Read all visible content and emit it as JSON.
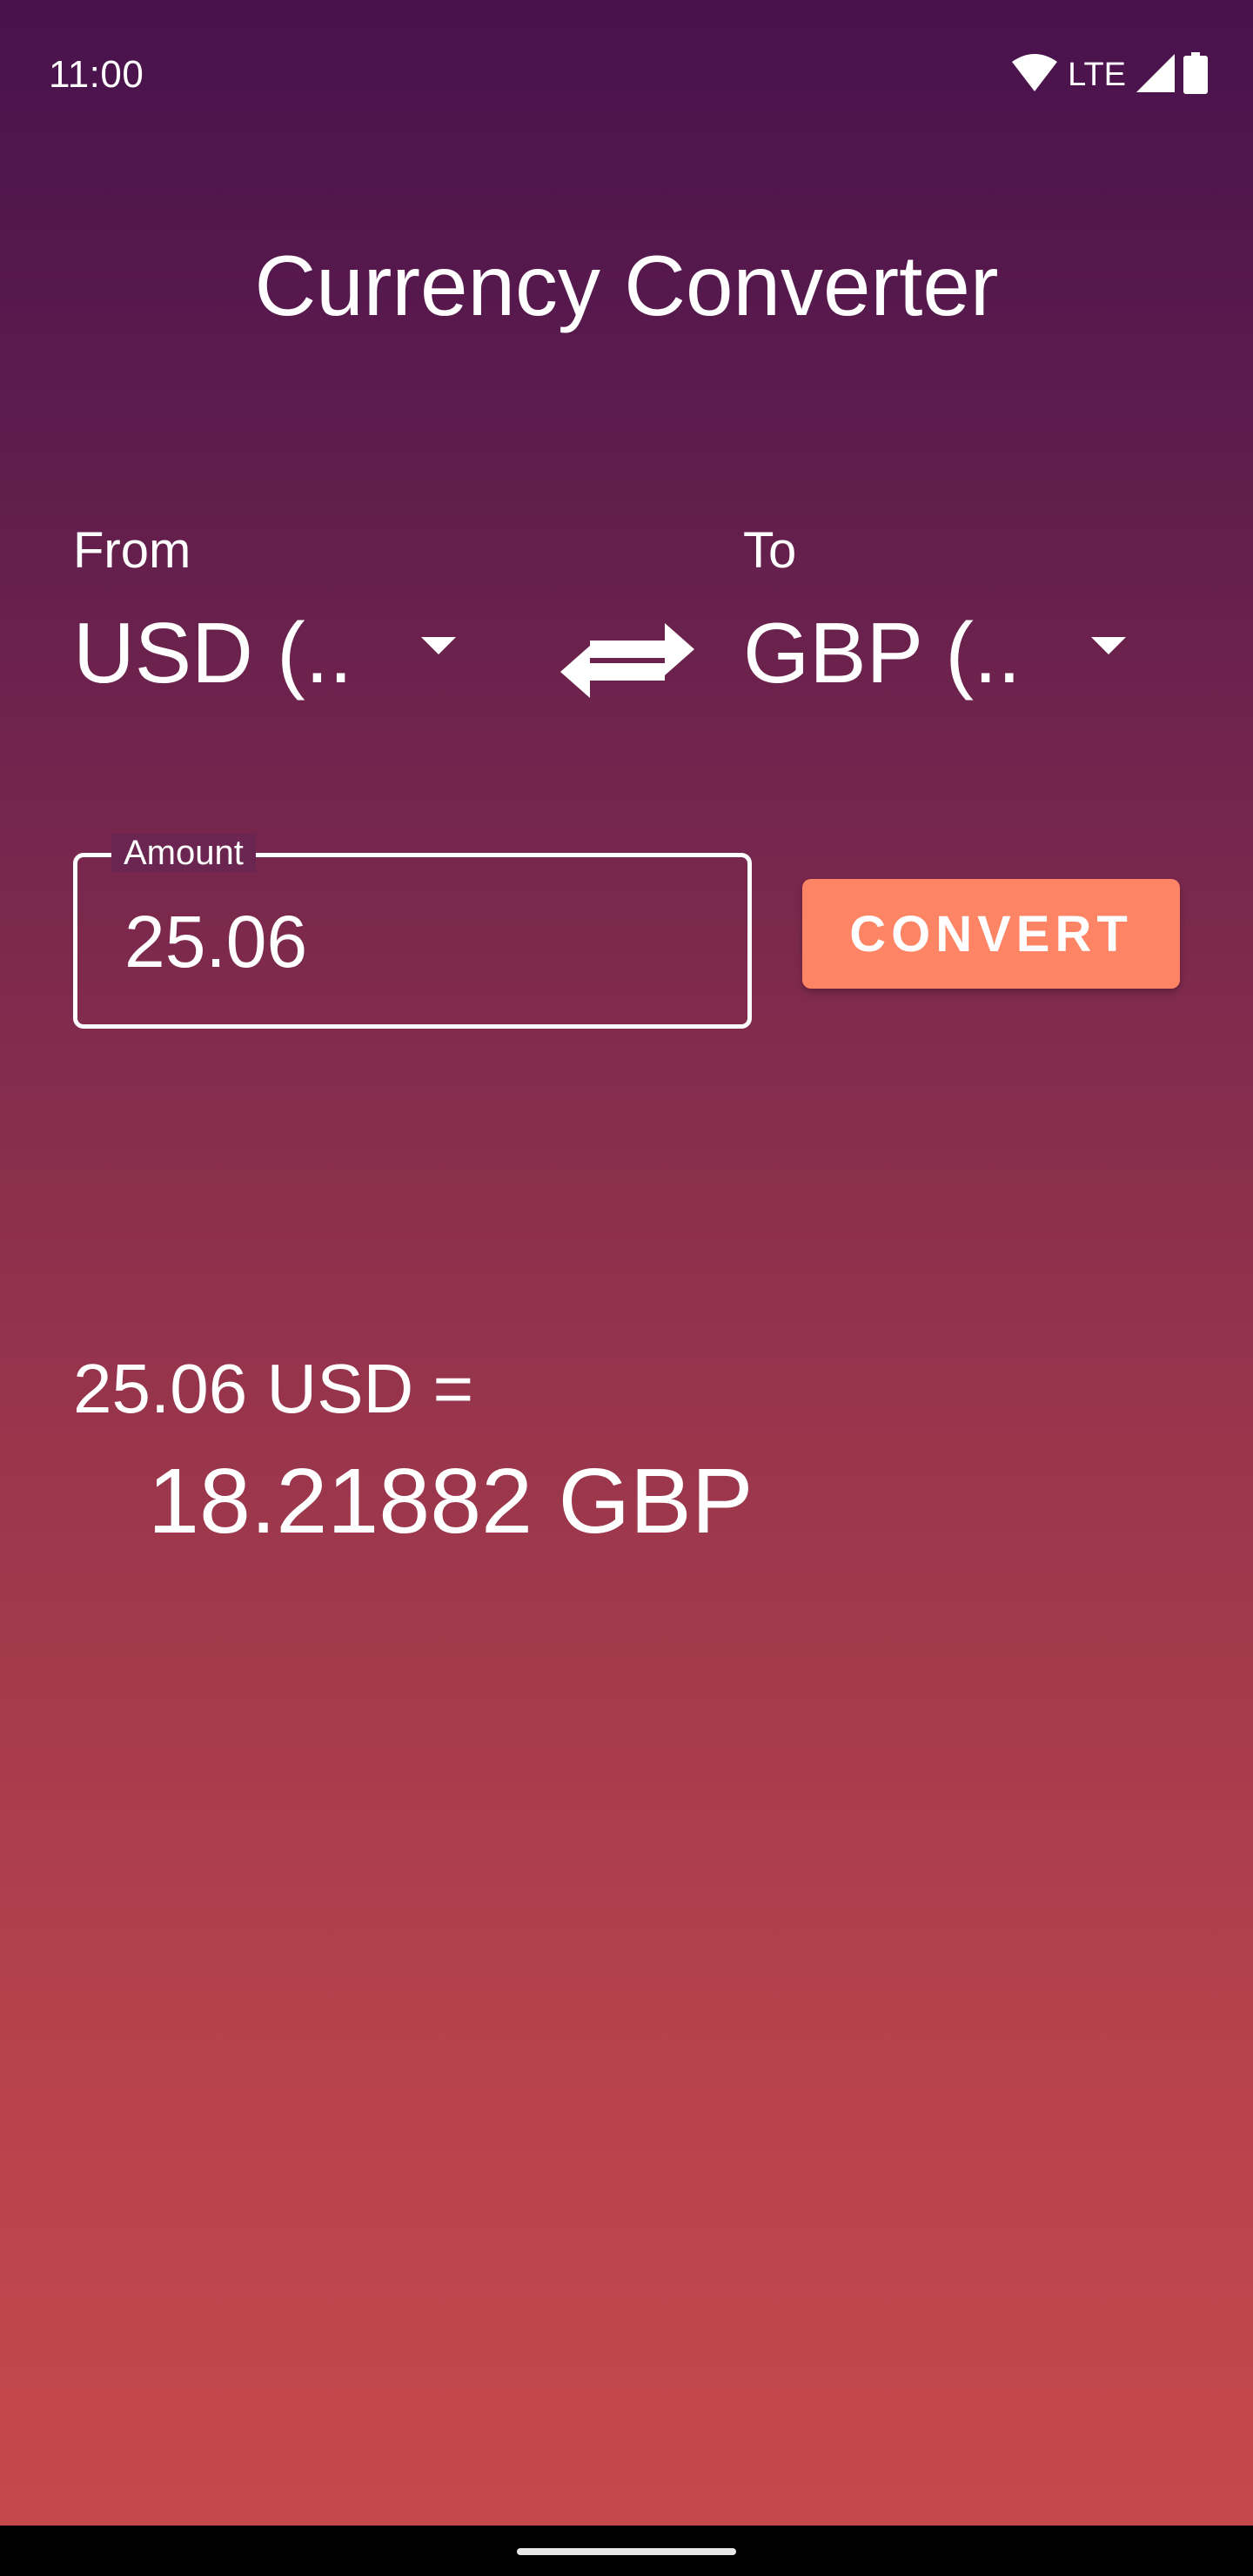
{
  "status_bar": {
    "time": "11:00",
    "network": "LTE",
    "icons": [
      "wifi-icon",
      "cell-signal-icon",
      "battery-icon"
    ]
  },
  "app": {
    "title": "Currency Converter"
  },
  "from": {
    "label": "From",
    "selected": "USD (.."
  },
  "to": {
    "label": "To",
    "selected": "GBP (.."
  },
  "swap": {
    "icon": "swap-arrows-icon"
  },
  "amount": {
    "label": "Amount",
    "value": "25.06"
  },
  "convert": {
    "label": "CONVERT"
  },
  "result": {
    "source": "25.06 USD =",
    "target": "18.21882 GBP"
  },
  "colors": {
    "gradient_top": "#48124d",
    "gradient_bottom": "#c74a4b",
    "accent": "#fd8565",
    "text": "#ffffff"
  }
}
